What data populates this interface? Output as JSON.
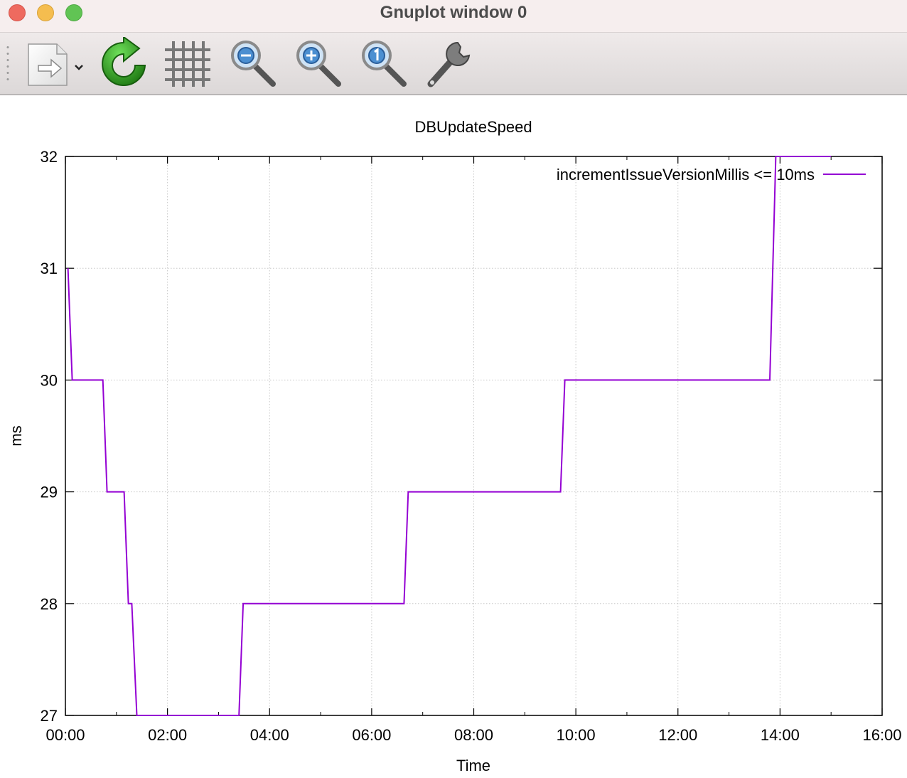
{
  "window": {
    "title": "Gnuplot window 0"
  },
  "toolbar": {
    "buttons": [
      {
        "name": "export",
        "icon": "export-document-icon"
      },
      {
        "name": "replot",
        "icon": "replot-icon"
      },
      {
        "name": "grid",
        "icon": "grid-icon"
      },
      {
        "name": "zoom-out",
        "icon": "zoom-out-icon"
      },
      {
        "name": "zoom-in",
        "icon": "zoom-in-icon"
      },
      {
        "name": "zoom-reset",
        "icon": "zoom-reset-icon"
      },
      {
        "name": "settings",
        "icon": "wrench-icon"
      }
    ]
  },
  "chart_data": {
    "type": "line",
    "title": "DBUpdateSpeed",
    "xlabel": "Time",
    "ylabel": "ms",
    "x_unit": "minutes",
    "xlim": [
      0,
      960
    ],
    "ylim": [
      27,
      32
    ],
    "x_tick_labels": [
      "00:00",
      "02:00",
      "04:00",
      "06:00",
      "08:00",
      "10:00",
      "12:00",
      "14:00",
      "16:00"
    ],
    "y_tick_labels": [
      "27",
      "28",
      "29",
      "30",
      "31",
      "32"
    ],
    "grid": true,
    "legend_position": "top-right",
    "series": [
      {
        "name": "incrementIssueVersionMillis <= 10ms",
        "color": "#9400d3",
        "points": [
          [
            3,
            31
          ],
          [
            8,
            30
          ],
          [
            44,
            30
          ],
          [
            49,
            29
          ],
          [
            69,
            29
          ],
          [
            74,
            28
          ],
          [
            78,
            28
          ],
          [
            84,
            27
          ],
          [
            204,
            27
          ],
          [
            209,
            28
          ],
          [
            398,
            28
          ],
          [
            403,
            29
          ],
          [
            582,
            29
          ],
          [
            587,
            30
          ],
          [
            828,
            30
          ],
          [
            835,
            32
          ],
          [
            900,
            32
          ]
        ]
      }
    ]
  }
}
